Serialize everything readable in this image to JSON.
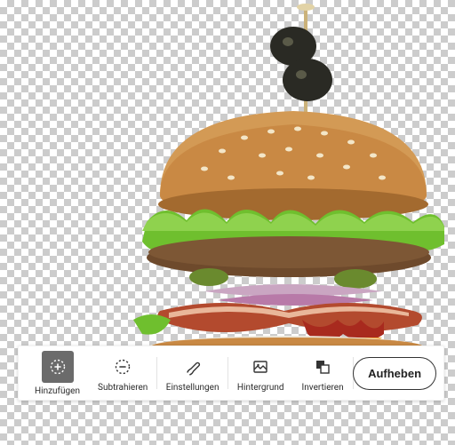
{
  "toolbar": {
    "add_label": "Hinzufügen",
    "subtract_label": "Subtrahieren",
    "settings_label": "Einstellungen",
    "background_label": "Hintergrund",
    "invert_label": "Invertieren",
    "cancel_label": "Aufheben"
  },
  "icons": {
    "add": "add-selection-icon",
    "subtract": "subtract-selection-icon",
    "settings": "brush-icon",
    "background": "image-icon",
    "invert": "invert-icon"
  },
  "colors": {
    "bun": "#d39a55",
    "bun_dark": "#a36a2f",
    "lettuce": "#6fbf2e",
    "lettuce_dark": "#3d7a12",
    "patty": "#6e4a2c",
    "bacon": "#b34a2e",
    "onion": "#b87aa8",
    "cheese": "#f4a93a",
    "olive": "#2a2a24",
    "skewer": "#cbb27a",
    "bottom_band": "#ede6d8"
  }
}
